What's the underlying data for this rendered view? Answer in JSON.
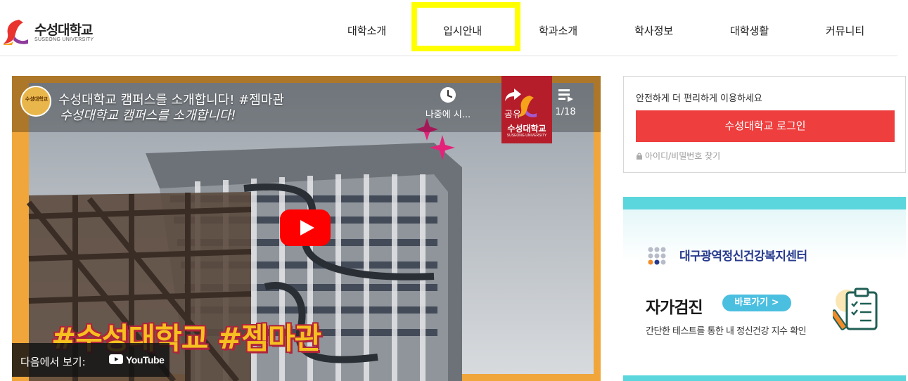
{
  "brand": {
    "name": "수성대학교",
    "sub": "SUSEONG UNIVERSITY"
  },
  "nav": {
    "items": [
      "대학소개",
      "입시안내",
      "학과소개",
      "학사정보",
      "대학생활",
      "커뮤니티"
    ],
    "highlighted": "입시안내",
    "highlight_color": "#ffff00"
  },
  "video": {
    "title": "수성대학교 캠퍼스를 소개합니다! #젬마관",
    "subtitle": "수성대학교 캠퍼스를 소개합니다!",
    "channel_avatar_text": "수성대학교",
    "watch_later_label": "나중에 시...",
    "share_label": "공유",
    "playlist_counter": "1/18",
    "badge_name": "수성대학교",
    "badge_sub": "SUSEONG UNIVERSITY",
    "hashtag_text": "#수성대학교 #젬마관",
    "watch_on_label": "다음에서 보기:",
    "youtube_word": "YouTube",
    "icons": [
      "clock-icon",
      "share-icon",
      "playlist-icon",
      "play-icon",
      "youtube-logo-icon"
    ]
  },
  "login": {
    "description": "안전하게 더 편리하게 이용하세요",
    "button_label": "수성대학교 로그인",
    "find_link": "아이디/비밀번호 찾기",
    "button_color": "#ee3e3e"
  },
  "banner": {
    "org_name": "대구광역정신건강복지센터",
    "title": "자가검진",
    "go_label": "바로가기 >",
    "description": "간단한 테스트를 통한 내 정신건강 지수 확인",
    "accent_color": "#5cd6dd"
  }
}
